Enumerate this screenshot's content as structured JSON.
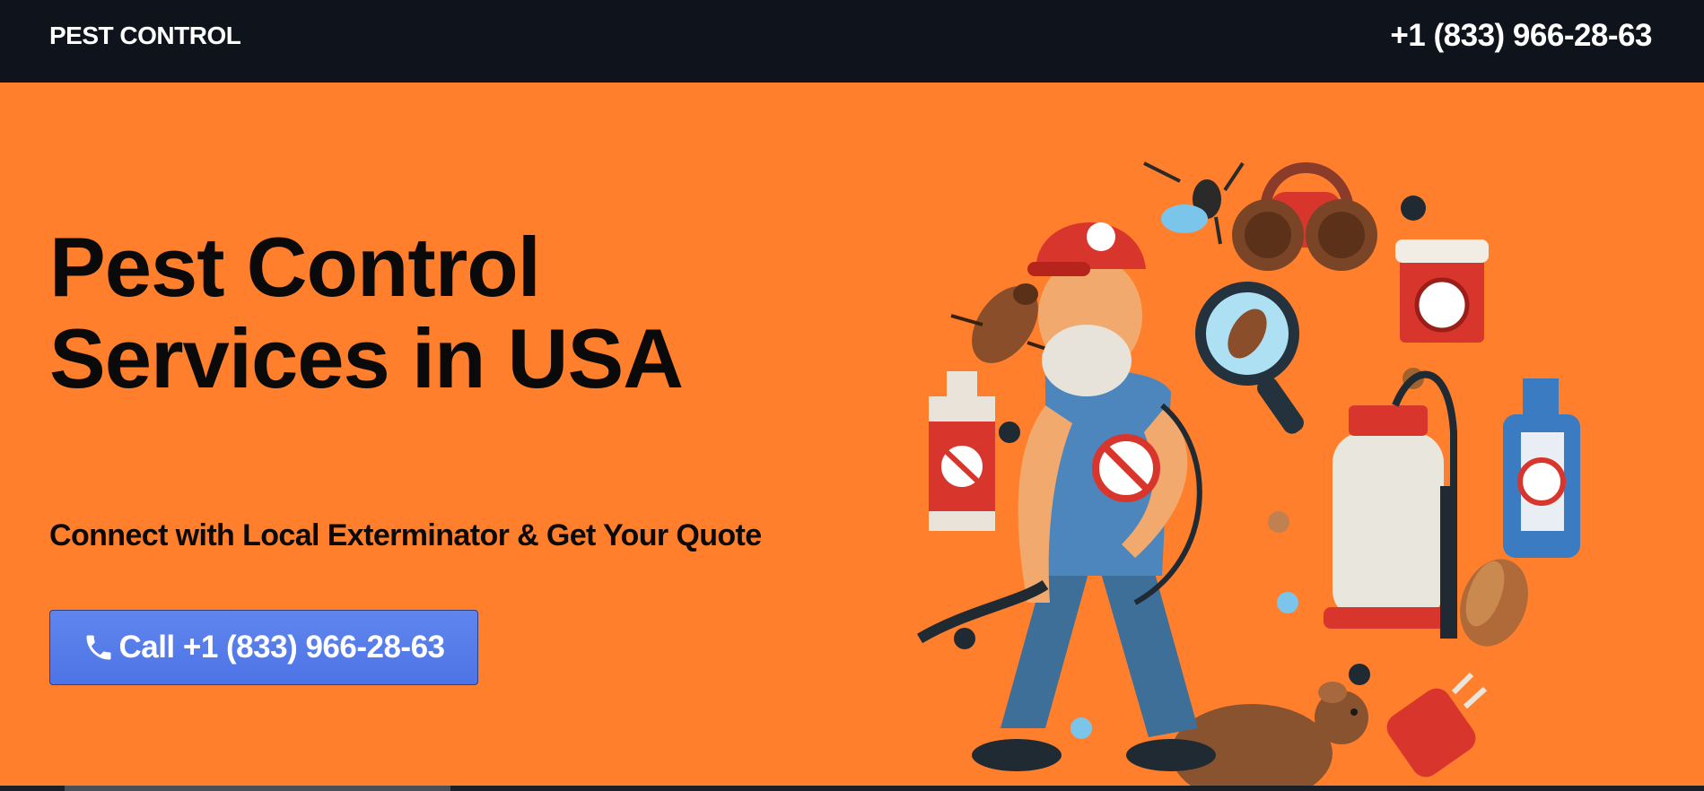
{
  "header": {
    "brand": "PEST CONTROL",
    "phone": "+1 (833) 966-28-63"
  },
  "hero": {
    "title_line1": "Pest Control",
    "title_line2": "Services in USA",
    "subtitle": "Connect with Local Exterminator & Get Your Quote",
    "cta_label": "Call +1 (833) 966-28-63",
    "cta_icon": "phone-icon"
  },
  "colors": {
    "header_bg": "#0f131c",
    "hero_bg": "#ff7f2c",
    "cta_bg": "#5b7fec",
    "text_dark": "#0a0a0a"
  }
}
